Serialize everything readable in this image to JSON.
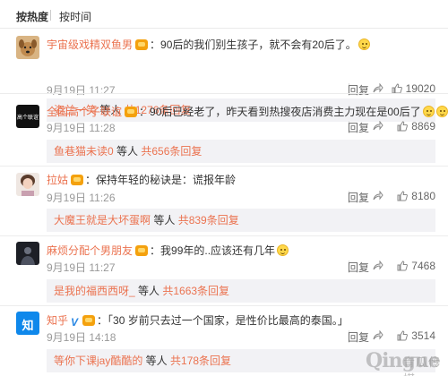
{
  "sort_tabs": {
    "hot": "按热度",
    "time": "按时间"
  },
  "comments": [
    {
      "username": "宇宙级戏精双鱼男",
      "text": "90后的我们别生孩子，就不会有20后了。",
      "emoji_count": 1,
      "date": "9月19日 11:27",
      "reply_label": "回复",
      "likes": "19020",
      "sub_reply": {
        "user": "姿兰一笑",
        "mid": " 等人 ",
        "link": "共1276条回复"
      }
    },
    {
      "username": "全国高个子联谊",
      "text": "90后已经老了，昨天看到热搜夜店消费主力现在是00后了",
      "emoji_count": 3,
      "date": "9月19日 11:28",
      "reply_label": "回复",
      "likes": "8869",
      "avatar_text": "高个联谊",
      "sub_reply": {
        "user": "鱼巷猫未读0",
        "mid": " 等人 ",
        "link": "共656条回复"
      }
    },
    {
      "username": "拉姑",
      "text": "保持年轻的秘诀是：谎报年龄",
      "emoji_count": 0,
      "date": "9月19日 11:26",
      "reply_label": "回复",
      "likes": "8180",
      "sub_reply": {
        "user": "大魔王就是大坏蛋啊",
        "mid": " 等人 ",
        "link": "共839条回复"
      }
    },
    {
      "username": "麻烦分配个男朋友",
      "text": "我99年的..应该还有几年",
      "emoji_count": 1,
      "date": "9月19日 11:27",
      "reply_label": "回复",
      "likes": "7468",
      "sub_reply": {
        "user": "是我的福西西呀_",
        "mid": " 等人 ",
        "link": "共1663条回复"
      }
    },
    {
      "username": "知乎",
      "text": "「30 岁前只去过一个国家，是性价比最高的泰国。」",
      "emoji_count": 0,
      "date": "9月19日 14:18",
      "reply_label": "回复",
      "likes": "3514",
      "avatar_text": "知",
      "verified_mark": "V",
      "sub_reply": {
        "user": "等你下课jay酷酷的",
        "mid": " 等人 ",
        "link": "共178条回复"
      }
    }
  ],
  "watermark": {
    "logo": "Qingue",
    "cn": "青瓜传媒"
  },
  "colors": {
    "link": "#eb7350",
    "meta": "#999999",
    "subreply_bg": "#f2f2f5",
    "zhihu_blue": "#0f88eb"
  }
}
